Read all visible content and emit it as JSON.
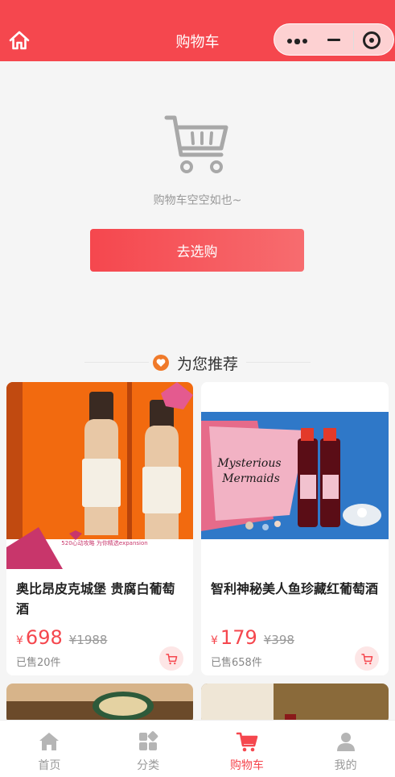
{
  "header": {
    "title": "购物车"
  },
  "empty": {
    "message": "购物车空空如也~",
    "button_label": "去选购"
  },
  "recommend": {
    "title": "为您推荐",
    "products": [
      {
        "name": "奥比昂皮克城堡 贵腐白葡萄酒",
        "currency": "¥",
        "price": "698",
        "original_price": "¥1988",
        "sold": "已售20件",
        "image_text": "520心动攻略 为你精选expansion"
      },
      {
        "name": "智利神秘美人鱼珍藏红葡萄酒",
        "currency": "¥",
        "price": "179",
        "original_price": "¥398",
        "sold": "已售658件",
        "image_text": "Mysterious Mermaids"
      }
    ]
  },
  "tabbar": {
    "items": [
      {
        "label": "首页",
        "icon": "home-icon",
        "active": false
      },
      {
        "label": "分类",
        "icon": "category-icon",
        "active": false
      },
      {
        "label": "购物车",
        "icon": "cart-icon",
        "active": true
      },
      {
        "label": "我的",
        "icon": "user-icon",
        "active": false
      }
    ]
  },
  "colors": {
    "accent": "#f5474e",
    "muted": "#999999"
  }
}
